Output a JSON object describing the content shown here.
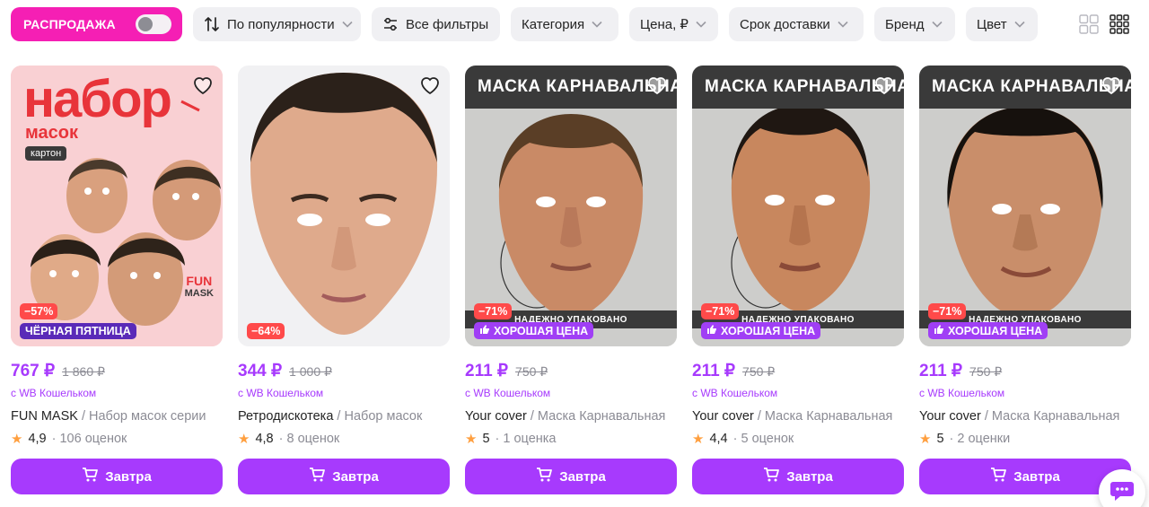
{
  "filters": {
    "sale_label": "РАСПРОДАЖА",
    "sort_label": "По популярности",
    "all_filters_label": "Все фильтры",
    "category_label": "Категория",
    "price_label": "Цена, ₽",
    "delivery_label": "Срок доставки",
    "brand_label": "Бренд",
    "color_label": "Цвет"
  },
  "banner_text": "МАСКА КАРНАВАЛЬНАЯ",
  "pack_text": "НАДЕЖНО УПАКОВАНО",
  "first_image": {
    "title": "набор",
    "subtitle": "масок",
    "tag": "картон",
    "logo_top": "FUN",
    "logo_bottom": "MASK"
  },
  "wallet_text": "с WB Кошельком",
  "buy_label": "Завтра",
  "products": [
    {
      "discount": "−57%",
      "promo": "ЧЁРНАЯ ПЯТНИЦА",
      "price": "767 ₽",
      "old_price": "1 860 ₽",
      "brand": "FUN MASK",
      "name": " / Набор масок серии",
      "rating": "4,9",
      "reviews": "· 106 оценок"
    },
    {
      "discount": "−64%",
      "promo": "",
      "price": "344 ₽",
      "old_price": "1 000 ₽",
      "brand": "Ретродискотека",
      "name": " / Набор масок",
      "rating": "4,8",
      "reviews": "· 8 оценок"
    },
    {
      "discount": "−71%",
      "promo": "ХОРОШАЯ ЦЕНА",
      "price": "211 ₽",
      "old_price": "750 ₽",
      "brand": "Your cover",
      "name": " / Маска Карнавальная",
      "rating": "5",
      "reviews": "· 1 оценка"
    },
    {
      "discount": "−71%",
      "promo": "ХОРОШАЯ ЦЕНА",
      "price": "211 ₽",
      "old_price": "750 ₽",
      "brand": "Your cover",
      "name": " / Маска Карнавальная",
      "rating": "4,4",
      "reviews": "· 5 оценок"
    },
    {
      "discount": "−71%",
      "promo": "ХОРОШАЯ ЦЕНА",
      "price": "211 ₽",
      "old_price": "750 ₽",
      "brand": "Your cover",
      "name": " / Маска Карнавальная",
      "rating": "5",
      "reviews": "· 2 оценки"
    }
  ],
  "colors": {
    "accent": "#a73afd",
    "sale": "#f51fb4",
    "discount": "#ff4a4a",
    "black_friday": "#5a2ab8",
    "good_price": "#a03ff5"
  },
  "icons": [
    "sort-icon",
    "filter-sliders-icon",
    "chevron-down-icon",
    "grid-large-icon",
    "grid-small-icon",
    "heart-icon",
    "thumbs-up-icon",
    "cart-icon",
    "chat-icon",
    "star-icon"
  ]
}
